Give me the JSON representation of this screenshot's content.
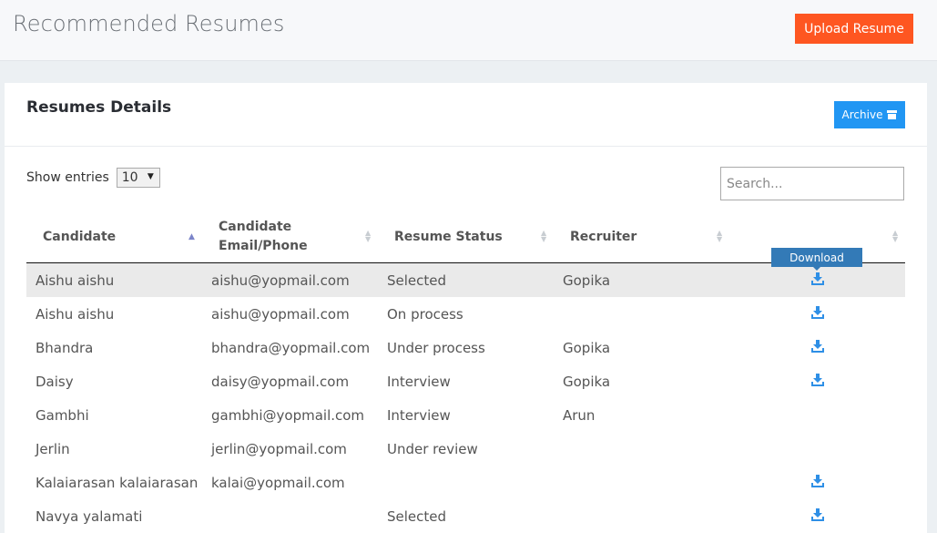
{
  "header": {
    "title": "Recommended Resumes",
    "upload_label": "Upload Resume"
  },
  "panel": {
    "title": "Resumes Details",
    "archive_label": "Archive"
  },
  "controls": {
    "show_entries_label": "Show entries",
    "entries_value": "10",
    "search_placeholder": "Search..."
  },
  "table": {
    "columns": [
      "Candidate",
      "Candidate Email/Phone",
      "Resume Status",
      "Recruiter",
      ""
    ],
    "sorted_column": "Candidate",
    "rows": [
      {
        "candidate": "Aishu aishu",
        "email": "aishu@yopmail.com",
        "status": "Selected",
        "recruiter": "Gopika",
        "download": true
      },
      {
        "candidate": "Aishu aishu",
        "email": "aishu@yopmail.com",
        "status": "On process",
        "recruiter": "",
        "download": true
      },
      {
        "candidate": "Bhandra",
        "email": "bhandra@yopmail.com",
        "status": "Under process",
        "recruiter": "Gopika",
        "download": true
      },
      {
        "candidate": "Daisy",
        "email": "daisy@yopmail.com",
        "status": "Interview",
        "recruiter": "Gopika",
        "download": true
      },
      {
        "candidate": "Gambhi",
        "email": "gambhi@yopmail.com",
        "status": "Interview",
        "recruiter": "Arun",
        "download": false
      },
      {
        "candidate": "Jerlin",
        "email": "jerlin@yopmail.com",
        "status": "Under review",
        "recruiter": "",
        "download": false
      },
      {
        "candidate": "Kalaiarasan kalaiarasan",
        "email": "kalai@yopmail.com",
        "status": "",
        "recruiter": "",
        "download": true
      },
      {
        "candidate": "Navya yalamati",
        "email": "",
        "status": "Selected",
        "recruiter": "",
        "download": true
      }
    ]
  },
  "tooltip": {
    "text": "Download"
  },
  "colors": {
    "upload_button": "#fe5621",
    "archive_button": "#2196f3",
    "tooltip": "#337ab7",
    "download_icon": "#2e8fe6"
  }
}
